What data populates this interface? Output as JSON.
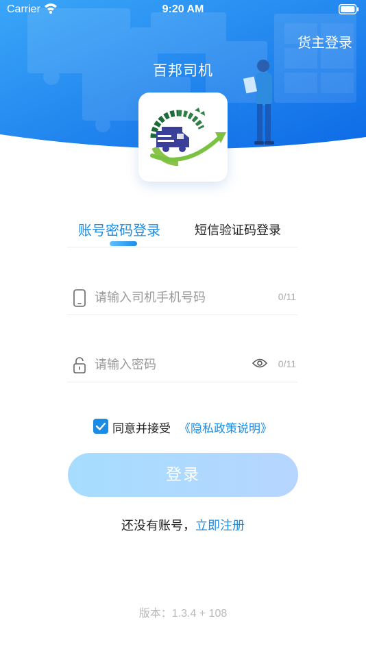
{
  "status_bar": {
    "carrier": "Carrier",
    "time": "9:20 AM"
  },
  "header": {
    "owner_login_label": "货主登录",
    "app_title": "百邦司机"
  },
  "tabs": [
    {
      "label": "账号密码登录",
      "active": true
    },
    {
      "label": "短信验证码登录",
      "active": false
    }
  ],
  "phone_field": {
    "placeholder": "请输入司机手机号码",
    "value": "",
    "counter": "0/11"
  },
  "password_field": {
    "placeholder": "请输入密码",
    "value": "",
    "counter": "0/11"
  },
  "agreement": {
    "checked": true,
    "text": "同意并接受",
    "link_text": "《隐私政策说明》"
  },
  "login_button_label": "登录",
  "register": {
    "prompt": "还没有账号，",
    "link_text": "立即注册"
  },
  "version": {
    "label": "版本：",
    "value": "1.3.4 + 108"
  },
  "colors": {
    "accent": "#1a8ce6",
    "header_gradient_start": "#2f9bf5",
    "header_gradient_end": "#0f6ee8",
    "button_gradient_start": "#a6ddff",
    "button_gradient_end": "#b6d5ff"
  },
  "icons": {
    "phone_field": "phone-icon",
    "password_field": "lock-icon",
    "password_visibility": "eye-icon",
    "agreement": "checkbox-checked-icon",
    "status_wifi": "wifi-icon",
    "status_battery": "battery-icon"
  }
}
